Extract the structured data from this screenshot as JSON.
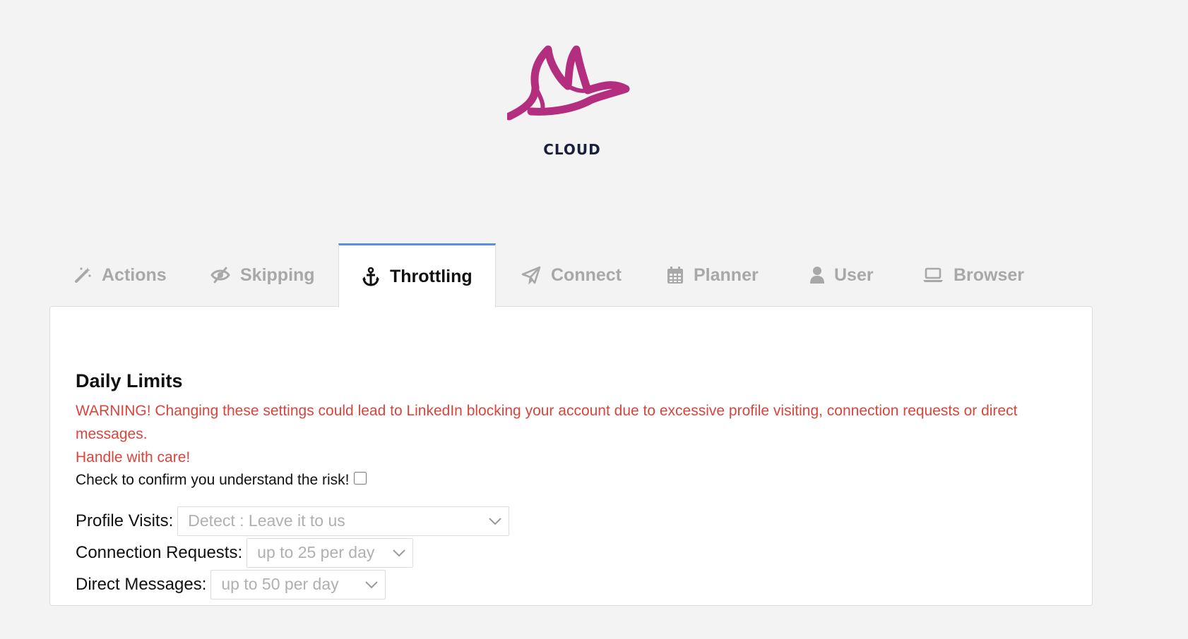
{
  "brand": {
    "name": "CLOUD",
    "logo_color": "#b42e80"
  },
  "tabs": [
    {
      "label": "Actions",
      "icon": "magic-wand-icon",
      "active": false
    },
    {
      "label": "Skipping",
      "icon": "eye-slash-icon",
      "active": false
    },
    {
      "label": "Throttling",
      "icon": "anchor-icon",
      "active": true
    },
    {
      "label": "Connect",
      "icon": "paper-plane-icon",
      "active": false
    },
    {
      "label": "Planner",
      "icon": "calendar-icon",
      "active": false
    },
    {
      "label": "User",
      "icon": "user-icon",
      "active": false
    },
    {
      "label": "Browser",
      "icon": "laptop-icon",
      "active": false
    }
  ],
  "daily_limits": {
    "title": "Daily Limits",
    "warning_line1": "WARNING! Changing these settings could lead to LinkedIn blocking your account due to excessive profile visiting, connection requests or direct messages.",
    "warning_line2": "Handle with care!",
    "confirm_label": "Check to confirm you understand the risk!",
    "confirm_checked": false,
    "fields": [
      {
        "label": "Profile Visits:",
        "value": "Detect : Leave it to us"
      },
      {
        "label": "Connection Requests:",
        "value": "up to 25 per day"
      },
      {
        "label": "Direct Messages:",
        "value": "up to 50 per day"
      }
    ]
  },
  "colors": {
    "accent_tab_border": "#5b8ee0",
    "warning": "#d9453d",
    "inactive_tab": "#a8a8a8"
  }
}
